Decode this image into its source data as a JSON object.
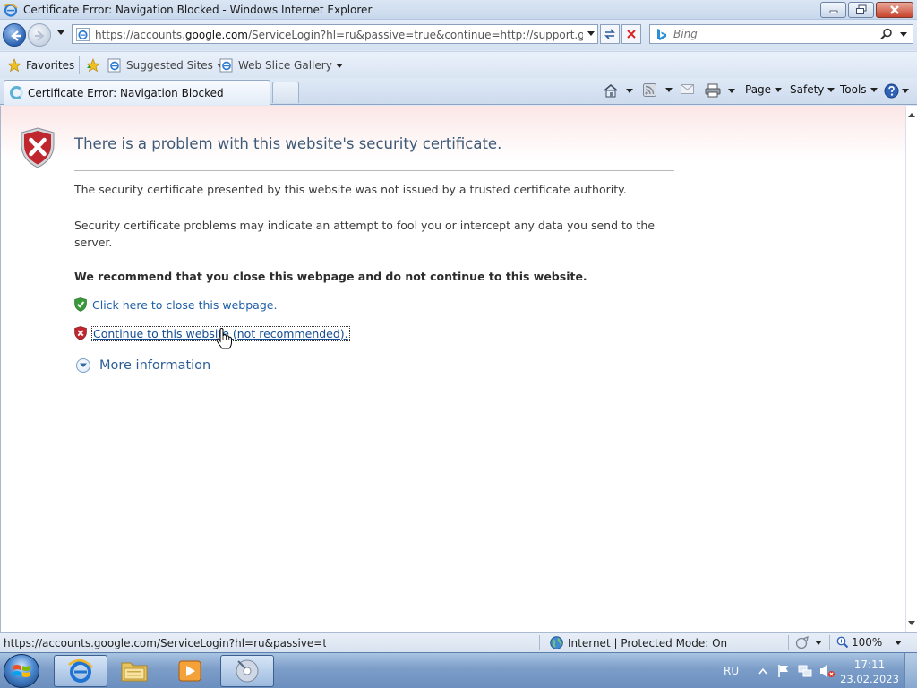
{
  "window": {
    "title": "Certificate Error: Navigation Blocked - Windows Internet Explorer"
  },
  "address": {
    "url_prefix": "https://accounts.",
    "url_host": "google.com",
    "url_rest": "/ServiceLogin?hl=ru&passive=true&continue=http://support.google.con",
    "search_placeholder": "Bing"
  },
  "favorites": {
    "favorites_label": "Favorites",
    "items": [
      {
        "label": "Suggested Sites"
      },
      {
        "label": "Web Slice Gallery"
      }
    ]
  },
  "tabs": {
    "active_tab": "Certificate Error: Navigation Blocked"
  },
  "command_bar": {
    "page": "Page",
    "safety": "Safety",
    "tools": "Tools"
  },
  "page": {
    "headline": "There is a problem with this website's security certificate.",
    "p1": "The security certificate presented by this website was not issued by a trusted certificate authority.",
    "p2": "Security certificate problems may indicate an attempt to fool you or intercept any data you send to the server.",
    "recommend": "We recommend that you close this webpage and do not continue to this website.",
    "close_link": "Click here to close this webpage.",
    "continue_link": "Continue to this website (not recommended).",
    "more_info": "More information"
  },
  "statusbar": {
    "url": "https://accounts.google.com/ServiceLogin?hl=ru&passive=true&co",
    "zone": "Internet | Protected Mode: On",
    "zoom": "100%"
  },
  "taskbar": {
    "language": "RU",
    "time": "17:11",
    "date": "23.02.2023"
  },
  "colors": {
    "link": "#1f5fa8",
    "headline": "#3d5a78",
    "shield_red": "#c0262d",
    "shield_green": "#3a9a3a"
  }
}
